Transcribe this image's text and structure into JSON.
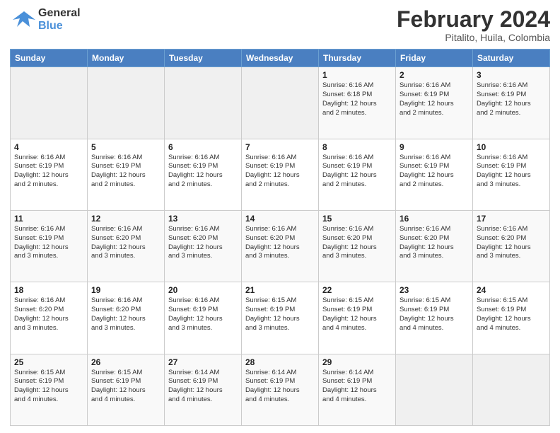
{
  "logo": {
    "line1": "General",
    "line2": "Blue"
  },
  "title": "February 2024",
  "subtitle": "Pitalito, Huila, Colombia",
  "days_header": [
    "Sunday",
    "Monday",
    "Tuesday",
    "Wednesday",
    "Thursday",
    "Friday",
    "Saturday"
  ],
  "weeks": [
    [
      {
        "day": "",
        "info": ""
      },
      {
        "day": "",
        "info": ""
      },
      {
        "day": "",
        "info": ""
      },
      {
        "day": "",
        "info": ""
      },
      {
        "day": "1",
        "info": "Sunrise: 6:16 AM\nSunset: 6:18 PM\nDaylight: 12 hours\nand 2 minutes."
      },
      {
        "day": "2",
        "info": "Sunrise: 6:16 AM\nSunset: 6:19 PM\nDaylight: 12 hours\nand 2 minutes."
      },
      {
        "day": "3",
        "info": "Sunrise: 6:16 AM\nSunset: 6:19 PM\nDaylight: 12 hours\nand 2 minutes."
      }
    ],
    [
      {
        "day": "4",
        "info": "Sunrise: 6:16 AM\nSunset: 6:19 PM\nDaylight: 12 hours\nand 2 minutes."
      },
      {
        "day": "5",
        "info": "Sunrise: 6:16 AM\nSunset: 6:19 PM\nDaylight: 12 hours\nand 2 minutes."
      },
      {
        "day": "6",
        "info": "Sunrise: 6:16 AM\nSunset: 6:19 PM\nDaylight: 12 hours\nand 2 minutes."
      },
      {
        "day": "7",
        "info": "Sunrise: 6:16 AM\nSunset: 6:19 PM\nDaylight: 12 hours\nand 2 minutes."
      },
      {
        "day": "8",
        "info": "Sunrise: 6:16 AM\nSunset: 6:19 PM\nDaylight: 12 hours\nand 2 minutes."
      },
      {
        "day": "9",
        "info": "Sunrise: 6:16 AM\nSunset: 6:19 PM\nDaylight: 12 hours\nand 2 minutes."
      },
      {
        "day": "10",
        "info": "Sunrise: 6:16 AM\nSunset: 6:19 PM\nDaylight: 12 hours\nand 3 minutes."
      }
    ],
    [
      {
        "day": "11",
        "info": "Sunrise: 6:16 AM\nSunset: 6:19 PM\nDaylight: 12 hours\nand 3 minutes."
      },
      {
        "day": "12",
        "info": "Sunrise: 6:16 AM\nSunset: 6:20 PM\nDaylight: 12 hours\nand 3 minutes."
      },
      {
        "day": "13",
        "info": "Sunrise: 6:16 AM\nSunset: 6:20 PM\nDaylight: 12 hours\nand 3 minutes."
      },
      {
        "day": "14",
        "info": "Sunrise: 6:16 AM\nSunset: 6:20 PM\nDaylight: 12 hours\nand 3 minutes."
      },
      {
        "day": "15",
        "info": "Sunrise: 6:16 AM\nSunset: 6:20 PM\nDaylight: 12 hours\nand 3 minutes."
      },
      {
        "day": "16",
        "info": "Sunrise: 6:16 AM\nSunset: 6:20 PM\nDaylight: 12 hours\nand 3 minutes."
      },
      {
        "day": "17",
        "info": "Sunrise: 6:16 AM\nSunset: 6:20 PM\nDaylight: 12 hours\nand 3 minutes."
      }
    ],
    [
      {
        "day": "18",
        "info": "Sunrise: 6:16 AM\nSunset: 6:20 PM\nDaylight: 12 hours\nand 3 minutes."
      },
      {
        "day": "19",
        "info": "Sunrise: 6:16 AM\nSunset: 6:20 PM\nDaylight: 12 hours\nand 3 minutes."
      },
      {
        "day": "20",
        "info": "Sunrise: 6:16 AM\nSunset: 6:19 PM\nDaylight: 12 hours\nand 3 minutes."
      },
      {
        "day": "21",
        "info": "Sunrise: 6:15 AM\nSunset: 6:19 PM\nDaylight: 12 hours\nand 3 minutes."
      },
      {
        "day": "22",
        "info": "Sunrise: 6:15 AM\nSunset: 6:19 PM\nDaylight: 12 hours\nand 4 minutes."
      },
      {
        "day": "23",
        "info": "Sunrise: 6:15 AM\nSunset: 6:19 PM\nDaylight: 12 hours\nand 4 minutes."
      },
      {
        "day": "24",
        "info": "Sunrise: 6:15 AM\nSunset: 6:19 PM\nDaylight: 12 hours\nand 4 minutes."
      }
    ],
    [
      {
        "day": "25",
        "info": "Sunrise: 6:15 AM\nSunset: 6:19 PM\nDaylight: 12 hours\nand 4 minutes."
      },
      {
        "day": "26",
        "info": "Sunrise: 6:15 AM\nSunset: 6:19 PM\nDaylight: 12 hours\nand 4 minutes."
      },
      {
        "day": "27",
        "info": "Sunrise: 6:14 AM\nSunset: 6:19 PM\nDaylight: 12 hours\nand 4 minutes."
      },
      {
        "day": "28",
        "info": "Sunrise: 6:14 AM\nSunset: 6:19 PM\nDaylight: 12 hours\nand 4 minutes."
      },
      {
        "day": "29",
        "info": "Sunrise: 6:14 AM\nSunset: 6:19 PM\nDaylight: 12 hours\nand 4 minutes."
      },
      {
        "day": "",
        "info": ""
      },
      {
        "day": "",
        "info": ""
      }
    ]
  ]
}
